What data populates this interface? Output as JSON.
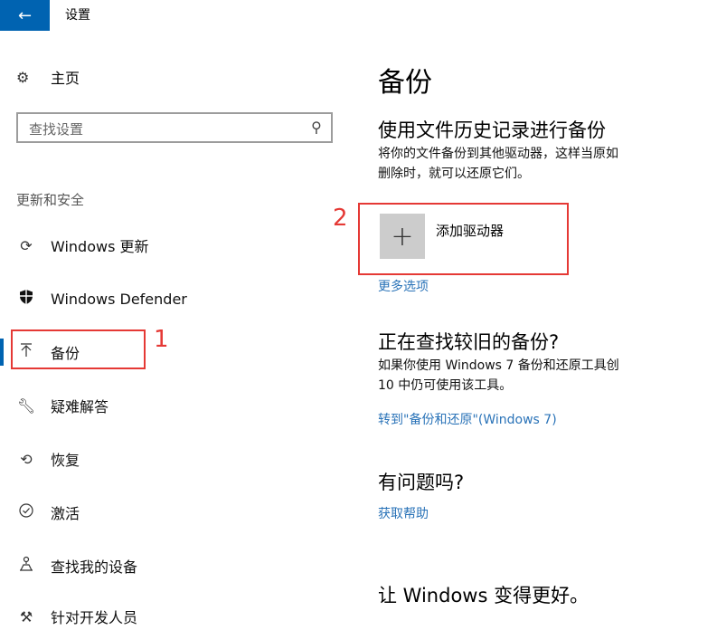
{
  "window": {
    "back_icon": "back-arrow-icon",
    "title": "设置",
    "accent": "#0063b1"
  },
  "sidebar": {
    "home": {
      "icon": "gear-icon",
      "label": "主页"
    },
    "search": {
      "placeholder": "查找设置",
      "icon": "search-icon"
    },
    "section_title": "更新和安全",
    "items": [
      {
        "icon": "sync-icon",
        "label": "Windows 更新"
      },
      {
        "icon": "shield-icon",
        "label": "Windows Defender"
      },
      {
        "icon": "backup-arrow-icon",
        "label": "备份",
        "selected": true
      },
      {
        "icon": "wrench-icon",
        "label": "疑难解答"
      },
      {
        "icon": "restore-icon",
        "label": "恢复"
      },
      {
        "icon": "check-circle-icon",
        "label": "激活"
      },
      {
        "icon": "find-device-icon",
        "label": "查找我的设备"
      },
      {
        "icon": "developer-icon",
        "label": "针对开发人员"
      }
    ]
  },
  "main": {
    "title": "备份",
    "file_history": {
      "heading": "使用文件历史记录进行备份",
      "desc_line1": "将你的文件备份到其他驱动器，这样当原如",
      "desc_line2": "删除时，就可以还原它们。",
      "add_drive_icon": "plus-icon",
      "add_drive_label": "添加驱动器",
      "more_options": "更多选项"
    },
    "older_backup": {
      "heading": "正在查找较旧的备份?",
      "desc_line1": "如果你使用 Windows 7 备份和还原工具创",
      "desc_line2": "10 中仍可使用该工具。",
      "link": "转到\"备份和还原\"(Windows 7)"
    },
    "questions": {
      "heading": "有问题吗?",
      "link": "获取帮助"
    },
    "improve": {
      "heading": "让 Windows 变得更好。"
    }
  },
  "annotations": {
    "marker1": "1",
    "marker2": "2",
    "color": "#e53935"
  }
}
